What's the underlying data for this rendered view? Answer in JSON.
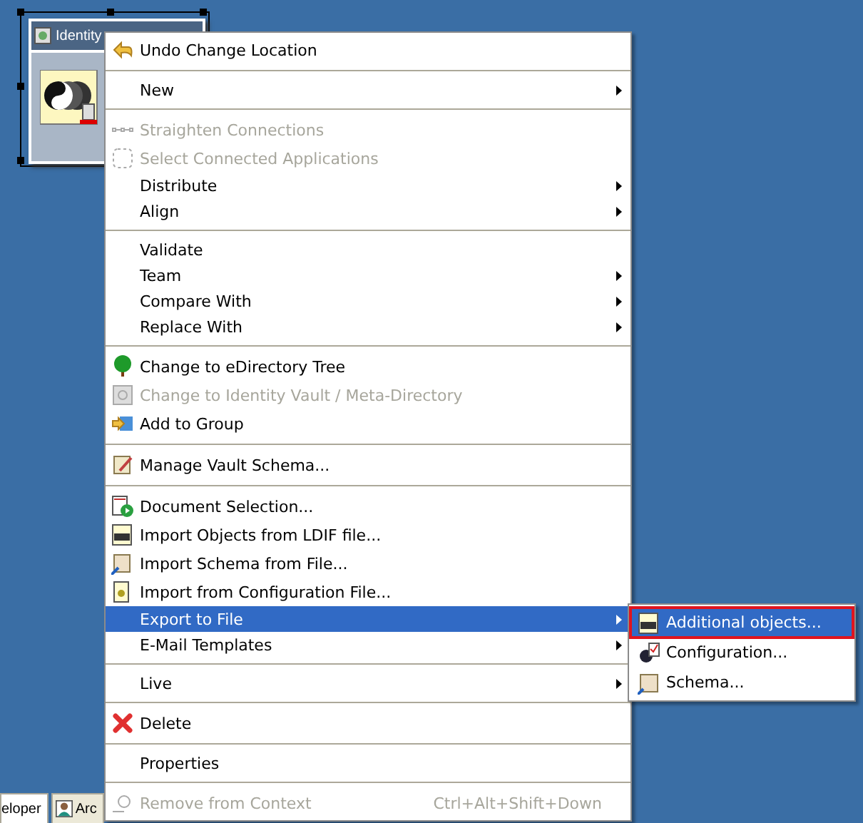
{
  "node": {
    "title": "Identity",
    "selected": true
  },
  "menu": [
    {
      "kind": "item",
      "label": "Undo Change Location",
      "disabled": false,
      "submenu": false,
      "selected": false
    },
    {
      "kind": "separator"
    },
    {
      "kind": "item",
      "label": "New",
      "disabled": false,
      "submenu": true,
      "selected": false
    },
    {
      "kind": "separator"
    },
    {
      "kind": "item",
      "label": "Straighten Connections",
      "disabled": true,
      "submenu": false,
      "selected": false
    },
    {
      "kind": "item",
      "label": "Select Connected Applications",
      "disabled": true,
      "submenu": false,
      "selected": false
    },
    {
      "kind": "item",
      "label": "Distribute",
      "disabled": false,
      "submenu": true,
      "selected": false
    },
    {
      "kind": "item",
      "label": "Align",
      "disabled": false,
      "submenu": true,
      "selected": false
    },
    {
      "kind": "separator"
    },
    {
      "kind": "item",
      "label": "Validate",
      "disabled": false,
      "submenu": false,
      "selected": false
    },
    {
      "kind": "item",
      "label": "Team",
      "disabled": false,
      "submenu": true,
      "selected": false
    },
    {
      "kind": "item",
      "label": "Compare With",
      "disabled": false,
      "submenu": true,
      "selected": false
    },
    {
      "kind": "item",
      "label": "Replace With",
      "disabled": false,
      "submenu": true,
      "selected": false
    },
    {
      "kind": "separator"
    },
    {
      "kind": "item",
      "label": "Change to eDirectory Tree",
      "disabled": false,
      "submenu": false,
      "selected": false
    },
    {
      "kind": "item",
      "label": "Change to Identity Vault / Meta-Directory",
      "disabled": true,
      "submenu": false,
      "selected": false
    },
    {
      "kind": "item",
      "label": "Add to Group",
      "disabled": false,
      "submenu": false,
      "selected": false
    },
    {
      "kind": "separator"
    },
    {
      "kind": "item",
      "label": "Manage Vault Schema...",
      "disabled": false,
      "submenu": false,
      "selected": false
    },
    {
      "kind": "separator"
    },
    {
      "kind": "item",
      "label": "Document Selection...",
      "disabled": false,
      "submenu": false,
      "selected": false
    },
    {
      "kind": "item",
      "label": "Import Objects from LDIF file...",
      "disabled": false,
      "submenu": false,
      "selected": false
    },
    {
      "kind": "item",
      "label": "Import Schema from File...",
      "disabled": false,
      "submenu": false,
      "selected": false
    },
    {
      "kind": "item",
      "label": "Import from Configuration File...",
      "disabled": false,
      "submenu": false,
      "selected": false
    },
    {
      "kind": "item",
      "label": "Export to File",
      "disabled": false,
      "submenu": true,
      "selected": true
    },
    {
      "kind": "item",
      "label": "E-Mail Templates",
      "disabled": false,
      "submenu": true,
      "selected": false
    },
    {
      "kind": "separator"
    },
    {
      "kind": "item",
      "label": "Live",
      "disabled": false,
      "submenu": true,
      "selected": false
    },
    {
      "kind": "separator"
    },
    {
      "kind": "item",
      "label": "Delete",
      "disabled": false,
      "submenu": false,
      "selected": false
    },
    {
      "kind": "separator"
    },
    {
      "kind": "item",
      "label": "Properties",
      "disabled": false,
      "submenu": false,
      "selected": false
    },
    {
      "kind": "separator"
    },
    {
      "kind": "item",
      "label": "Remove from Context",
      "disabled": true,
      "submenu": false,
      "selected": false,
      "shortcut": "Ctrl+Alt+Shift+Down"
    }
  ],
  "submenu": [
    {
      "label": "Additional objects...",
      "selected": true
    },
    {
      "label": "Configuration...",
      "selected": false
    },
    {
      "label": "Schema...",
      "selected": false
    }
  ],
  "tabs": [
    {
      "label": "eloper"
    },
    {
      "label": "Arc"
    }
  ]
}
